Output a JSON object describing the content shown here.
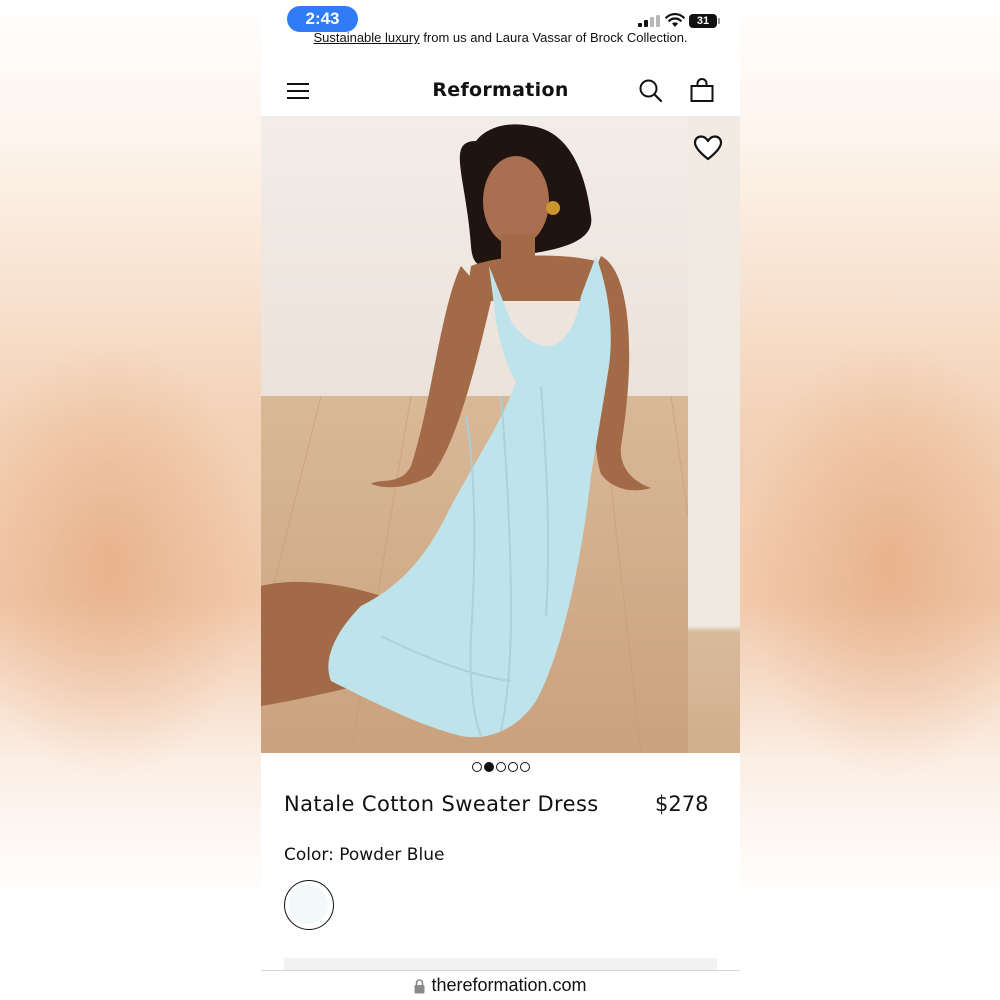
{
  "status_bar": {
    "time": "2:43",
    "battery": "31"
  },
  "promo": {
    "link_text": "Sustainable luxury",
    "text": " from us and Laura Vassar of Brock Collection."
  },
  "header": {
    "brand": "Reformation"
  },
  "product": {
    "name": "Natale Cotton Sweater Dress",
    "price": "$278",
    "color_label": "Color: Powder Blue",
    "selected_color": "Powder Blue"
  },
  "carousel": {
    "total_images": 5,
    "active_index": 1
  },
  "browser": {
    "url": "thereformation.com"
  },
  "colors": {
    "time_pill": "#2f7cf6",
    "dress": "#bfe3ea",
    "swatch": "#f3f8fa"
  },
  "icons": [
    "menu-icon",
    "search-icon",
    "bag-icon",
    "heart-icon",
    "lock-icon",
    "wifi-icon",
    "signal-icon",
    "battery-icon"
  ]
}
